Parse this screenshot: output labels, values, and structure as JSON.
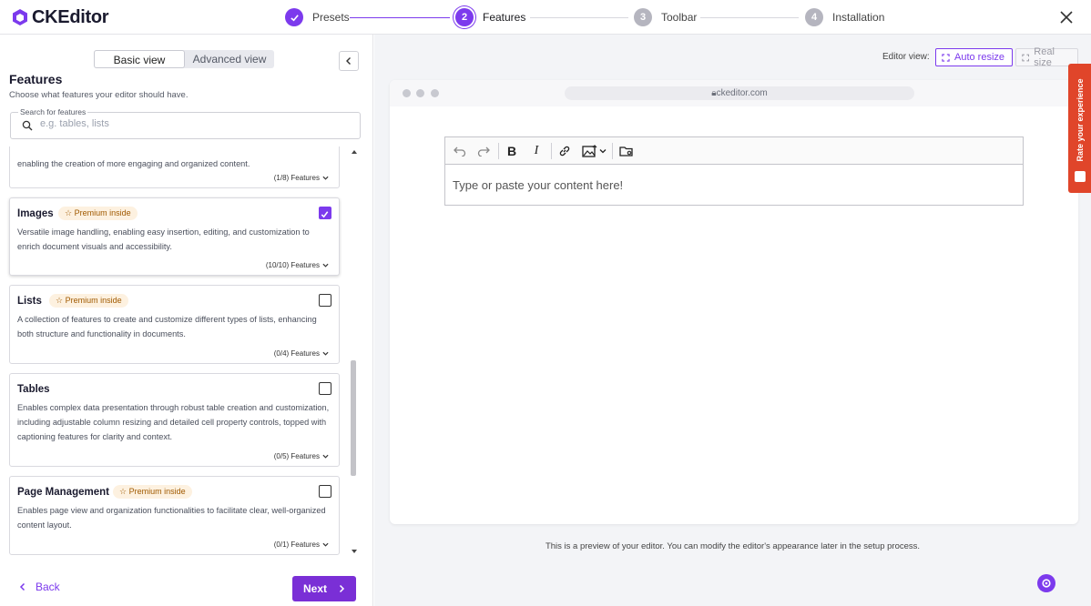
{
  "header": {
    "logo_text": "CKEditor",
    "steps": [
      {
        "num": "",
        "label": "Presets",
        "state": "done"
      },
      {
        "num": "2",
        "label": "Features",
        "state": "active"
      },
      {
        "num": "3",
        "label": "Toolbar",
        "state": "todo"
      },
      {
        "num": "4",
        "label": "Installation",
        "state": "todo"
      }
    ],
    "close_icon": "close-icon"
  },
  "sidebar": {
    "view_toggle": {
      "basic": "Basic view",
      "advanced": "Advanced view",
      "selected": "Basic view"
    },
    "title": "Features",
    "subtitle": "Choose what features your editor should have.",
    "search": {
      "legend": "Search for features",
      "placeholder": "e.g. tables, lists"
    },
    "cards": [
      {
        "name": "",
        "premium": false,
        "checked": false,
        "description": "enabling the creation of more engaging and organized content.",
        "count": "(1/8) Features"
      },
      {
        "name": "Images",
        "premium": true,
        "checked": true,
        "description": "Versatile image handling, enabling easy insertion, editing, and customization to enrich document visuals and accessibility.",
        "count": "(10/10) Features"
      },
      {
        "name": "Lists",
        "premium": true,
        "checked": false,
        "description": "A collection of features to create and customize different types of lists, enhancing both structure and functionality in documents.",
        "count": "(0/4) Features"
      },
      {
        "name": "Tables",
        "premium": false,
        "checked": false,
        "description": "Enables complex data presentation through robust table creation and customization, including adjustable column resizing and detailed cell property controls, topped with captioning features for clarity and context.",
        "count": "(0/5) Features"
      },
      {
        "name": "Page Management",
        "premium": true,
        "checked": false,
        "description": "Enables page view and organization functionalities to facilitate clear, well-organized content layout.",
        "count": "(0/1) Features"
      }
    ],
    "premium_label": "Premium inside",
    "back_label": "Back",
    "next_label": "Next"
  },
  "preview": {
    "editor_view_label": "Editor view:",
    "auto_resize_label": "Auto resize",
    "real_size_label": "Real size",
    "url": "ckeditor.com",
    "placeholder": "Type or paste your content here!",
    "note": "This is a preview of your editor. You can modify the editor's appearance later in the setup process.",
    "rate_label": "Rate your experience"
  },
  "colors": {
    "accent": "#7c3aed",
    "rate_tab": "#e0452a",
    "premium_bg": "#fdf1e0",
    "premium_text": "#a05a00"
  }
}
